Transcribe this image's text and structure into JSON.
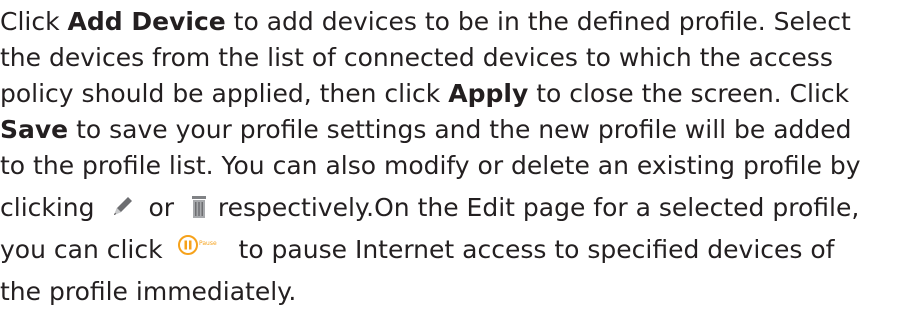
{
  "paragraph": {
    "l1_a": "Click ",
    "l1_b": "Add Device",
    "l1_c": " to add devices to be in the defined profile. Select",
    "l2": "the devices from the list of connected devices to which the access",
    "l3_a": "policy should be applied, then click ",
    "l3_b": "Apply",
    "l3_c": " to close the screen. Click",
    "l4_a": "Save",
    "l4_b": " to save your profile settings and the new profile will be added",
    "l5": "to the profile list. You can also modify or delete an existing profile by",
    "l6_a": "clicking",
    "l6_b": "or",
    "l6_c": "respectively.On the Edit page for a selected profile,",
    "l7_a": "you can click",
    "l7_b": "to pause Internet access to specified devices of",
    "l8": "the profile immediately."
  },
  "icons": {
    "edit": "pencil-icon",
    "delete": "trash-icon",
    "pause": "pause-icon",
    "pause_label": "Pause"
  },
  "colors": {
    "text": "#231f20",
    "pause_orange": "#f6a21b"
  }
}
